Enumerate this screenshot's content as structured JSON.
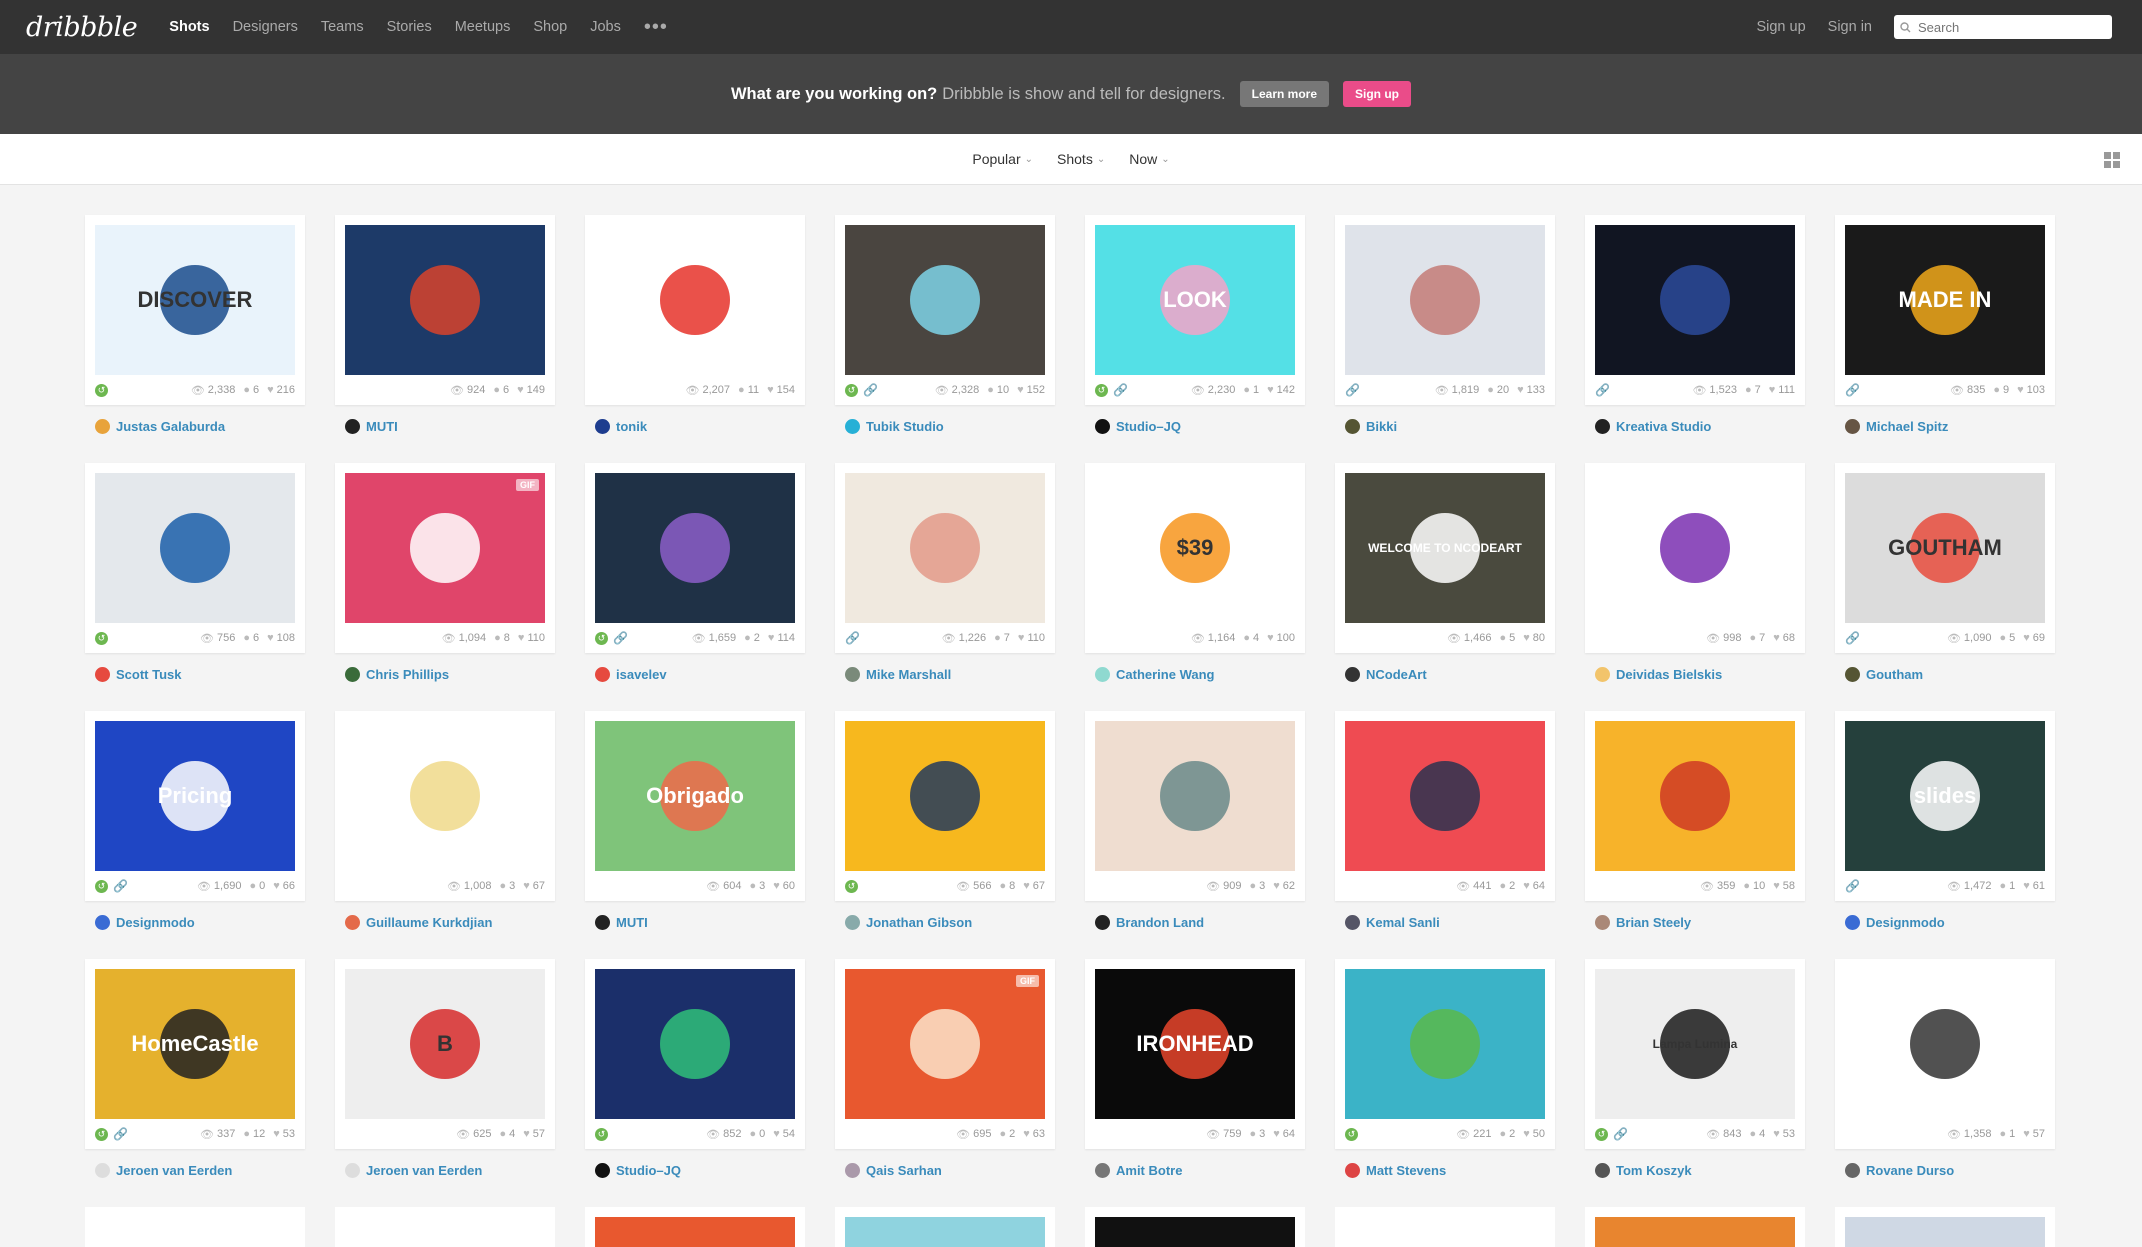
{
  "nav": {
    "logo": "dribbble",
    "links": [
      "Shots",
      "Designers",
      "Teams",
      "Stories",
      "Meetups",
      "Shop",
      "Jobs"
    ],
    "more": "•••",
    "sign_up": "Sign up",
    "sign_in": "Sign in",
    "search_placeholder": "Search"
  },
  "banner": {
    "question": "What are you working on?",
    "description": "Dribbble is show and tell for designers.",
    "learn_more": "Learn more",
    "sign_up": "Sign up"
  },
  "filters": {
    "sort": "Popular",
    "type": "Shots",
    "time": "Now"
  },
  "shots": [
    {
      "author": "Justas Galaburda",
      "views": "2,338",
      "comments": "6",
      "likes": "216",
      "rebound": true,
      "attach": false,
      "bg": "#e9f3fb",
      "accent": "#1a4b8c",
      "avatar": "#e8a33b",
      "text": "DISCOVER"
    },
    {
      "author": "MUTI",
      "views": "924",
      "comments": "6",
      "likes": "149",
      "rebound": false,
      "attach": false,
      "bg": "#1d3a68",
      "accent": "#d8432b",
      "avatar": "#222",
      "text": ""
    },
    {
      "author": "tonik",
      "views": "2,207",
      "comments": "11",
      "likes": "154",
      "rebound": false,
      "attach": false,
      "bg": "#ffffff",
      "accent": "#e6332a",
      "avatar": "#1e3d8f",
      "text": ""
    },
    {
      "author": "Tubik Studio",
      "views": "2,328",
      "comments": "10",
      "likes": "152",
      "rebound": true,
      "attach": true,
      "bg": "#4a4540",
      "accent": "#7ed3e8",
      "avatar": "#27b0d6",
      "text": ""
    },
    {
      "author": "Studio–JQ",
      "views": "2,230",
      "comments": "1",
      "likes": "142",
      "rebound": true,
      "attach": true,
      "bg": "#54e0e6",
      "accent": "#f3a3c8",
      "avatar": "#111",
      "text": "LOOK"
    },
    {
      "author": "Bikki",
      "views": "1,819",
      "comments": "20",
      "likes": "133",
      "rebound": false,
      "attach": true,
      "bg": "#dfe3ea",
      "accent": "#c47b77",
      "avatar": "#553",
      "text": ""
    },
    {
      "author": "Kreativa Studio",
      "views": "1,523",
      "comments": "7",
      "likes": "111",
      "rebound": false,
      "attach": true,
      "bg": "#111522",
      "accent": "#2b4a9a",
      "avatar": "#222",
      "text": ""
    },
    {
      "author": "Michael Spitz",
      "views": "835",
      "comments": "9",
      "likes": "103",
      "rebound": false,
      "attach": true,
      "bg": "#1a1a1a",
      "accent": "#f1a91b",
      "avatar": "#654",
      "text": "MADE IN"
    },
    {
      "author": "Scott Tusk",
      "views": "756",
      "comments": "6",
      "likes": "108",
      "rebound": true,
      "attach": false,
      "bg": "#e4e8ec",
      "accent": "#1b5ea9",
      "avatar": "#e64a3f",
      "text": ""
    },
    {
      "author": "Chris Phillips",
      "views": "1,094",
      "comments": "8",
      "likes": "110",
      "rebound": false,
      "attach": false,
      "bg": "#e0456a",
      "accent": "#ffffff",
      "avatar": "#3a6b3a",
      "text": "",
      "gif": true
    },
    {
      "author": "isavelev",
      "views": "1,659",
      "comments": "2",
      "likes": "114",
      "rebound": true,
      "attach": true,
      "bg": "#1f3146",
      "accent": "#8c5ec9",
      "avatar": "#e64a3f",
      "text": ""
    },
    {
      "author": "Mike Marshall",
      "views": "1,226",
      "comments": "7",
      "likes": "110",
      "rebound": false,
      "attach": true,
      "bg": "#f0e9df",
      "accent": "#e39a8a",
      "avatar": "#7a8a7a",
      "text": ""
    },
    {
      "author": "Catherine Wang",
      "views": "1,164",
      "comments": "4",
      "likes": "100",
      "rebound": false,
      "attach": false,
      "bg": "#ffffff",
      "accent": "#f7951d",
      "avatar": "#8fd9d0",
      "text": "$39"
    },
    {
      "author": "NCodeArt",
      "views": "1,466",
      "comments": "5",
      "likes": "80",
      "rebound": false,
      "attach": false,
      "bg": "#4a4a3e",
      "accent": "#ffffff",
      "avatar": "#333",
      "text": "WELCOME TO NCODEART"
    },
    {
      "author": "Deividas Bielskis",
      "views": "998",
      "comments": "7",
      "likes": "68",
      "rebound": false,
      "attach": false,
      "bg": "#ffffff",
      "accent": "#7a2fb0",
      "avatar": "#f2c46b",
      "text": ""
    },
    {
      "author": "Goutham",
      "views": "1,090",
      "comments": "5",
      "likes": "69",
      "rebound": false,
      "attach": true,
      "bg": "#dcdcdc",
      "accent": "#e84c3d",
      "avatar": "#553",
      "text": "GOUTHAM"
    },
    {
      "author": "Designmodo",
      "views": "1,690",
      "comments": "0",
      "likes": "66",
      "rebound": true,
      "attach": true,
      "bg": "#1f46c4",
      "accent": "#ffffff",
      "avatar": "#3a6bd4",
      "text": "Pricing"
    },
    {
      "author": "Guillaume Kurkdjian",
      "views": "1,008",
      "comments": "3",
      "likes": "67",
      "rebound": false,
      "attach": false,
      "bg": "#ffffff",
      "accent": "#f0d98a",
      "avatar": "#e46a4a",
      "text": "",
      "gif": true
    },
    {
      "author": "MUTI",
      "views": "604",
      "comments": "3",
      "likes": "60",
      "rebound": false,
      "attach": false,
      "bg": "#7fc47a",
      "accent": "#ef6a4a",
      "avatar": "#222",
      "text": "Obrigado"
    },
    {
      "author": "Jonathan Gibson",
      "views": "566",
      "comments": "8",
      "likes": "67",
      "rebound": true,
      "attach": false,
      "bg": "#f7b81e",
      "accent": "#23395d",
      "avatar": "#8aa",
      "text": ""
    },
    {
      "author": "Brandon Land",
      "views": "909",
      "comments": "3",
      "likes": "62",
      "rebound": false,
      "attach": false,
      "bg": "#efddd0",
      "accent": "#6a8a8a",
      "avatar": "#222",
      "text": ""
    },
    {
      "author": "Kemal Sanli",
      "views": "441",
      "comments": "2",
      "likes": "64",
      "rebound": false,
      "attach": false,
      "bg": "#ef4b52",
      "accent": "#2b3350",
      "avatar": "#556",
      "text": ""
    },
    {
      "author": "Brian Steely",
      "views": "359",
      "comments": "10",
      "likes": "58",
      "rebound": false,
      "attach": false,
      "bg": "#f7b32a",
      "accent": "#cf3a24",
      "avatar": "#a87",
      "text": ""
    },
    {
      "author": "Designmodo",
      "views": "1,472",
      "comments": "1",
      "likes": "61",
      "rebound": false,
      "attach": true,
      "bg": "#25403c",
      "accent": "#ffffff",
      "avatar": "#3a6bd4",
      "text": "slides"
    },
    {
      "author": "Jeroen van Eerden",
      "views": "337",
      "comments": "12",
      "likes": "53",
      "rebound": true,
      "attach": true,
      "bg": "#e5b12d",
      "accent": "#222",
      "avatar": "#ddd",
      "text": "HomeCastle"
    },
    {
      "author": "Jeroen van Eerden",
      "views": "625",
      "comments": "4",
      "likes": "57",
      "rebound": false,
      "attach": false,
      "bg": "#eeeeee",
      "accent": "#d62a2a",
      "avatar": "#ddd",
      "text": "B"
    },
    {
      "author": "Studio–JQ",
      "views": "852",
      "comments": "0",
      "likes": "54",
      "rebound": true,
      "attach": false,
      "bg": "#1b2f6a",
      "accent": "#2fbf79",
      "avatar": "#111",
      "text": ""
    },
    {
      "author": "Qais Sarhan",
      "views": "695",
      "comments": "2",
      "likes": "63",
      "rebound": false,
      "attach": false,
      "bg": "#e8582f",
      "accent": "#fbe3c9",
      "avatar": "#a9a",
      "text": "",
      "gif": true
    },
    {
      "author": "Amit Botre",
      "views": "759",
      "comments": "3",
      "likes": "64",
      "rebound": false,
      "attach": false,
      "bg": "#0a0a0a",
      "accent": "#e8452b",
      "avatar": "#777",
      "text": "IRONHEAD"
    },
    {
      "author": "Matt Stevens",
      "views": "221",
      "comments": "2",
      "likes": "50",
      "rebound": true,
      "attach": false,
      "bg": "#3bb3c7",
      "accent": "#5ab94a",
      "avatar": "#d44",
      "text": ""
    },
    {
      "author": "Tom Koszyk",
      "views": "843",
      "comments": "4",
      "likes": "53",
      "rebound": true,
      "attach": true,
      "bg": "#eeeeee",
      "accent": "#1a1a1a",
      "avatar": "#555",
      "text": "Lampa Lumina"
    },
    {
      "author": "Rovane Durso",
      "views": "1,358",
      "comments": "1",
      "likes": "57",
      "rebound": false,
      "attach": false,
      "bg": "#ffffff",
      "accent": "#333",
      "avatar": "#666",
      "text": ""
    }
  ],
  "partial_row": [
    {
      "bg": "#ffffff"
    },
    {
      "bg": "#ffffff"
    },
    {
      "bg": "#e8582f"
    },
    {
      "bg": "#8fd3df"
    },
    {
      "bg": "#111111"
    },
    {
      "bg": "#ffffff"
    },
    {
      "bg": "#e8852f"
    },
    {
      "bg": "#cfd8e4"
    }
  ]
}
